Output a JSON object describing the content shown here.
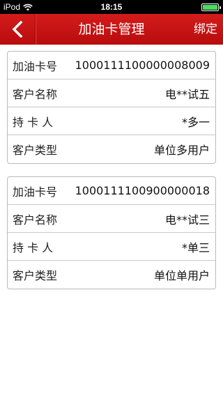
{
  "status_bar": {
    "carrier": "iPod",
    "time": "18:15"
  },
  "nav": {
    "title": "加油卡管理",
    "action": "绑定"
  },
  "cards": [
    {
      "rows": [
        {
          "label": "加油卡号",
          "value": "1000111100000008009"
        },
        {
          "label": "客户名称",
          "value": "电**试五"
        },
        {
          "label": "持 卡 人",
          "value": "*多一"
        },
        {
          "label": "客户类型",
          "value": "单位多用户"
        }
      ]
    },
    {
      "rows": [
        {
          "label": "加油卡号",
          "value": "1000111100900000018"
        },
        {
          "label": "客户名称",
          "value": "电**试三"
        },
        {
          "label": "持 卡 人",
          "value": "*单三"
        },
        {
          "label": "客户类型",
          "value": "单位单用户"
        }
      ]
    }
  ],
  "colors": {
    "nav_background": "#c41414",
    "battery": "#4cd964"
  }
}
